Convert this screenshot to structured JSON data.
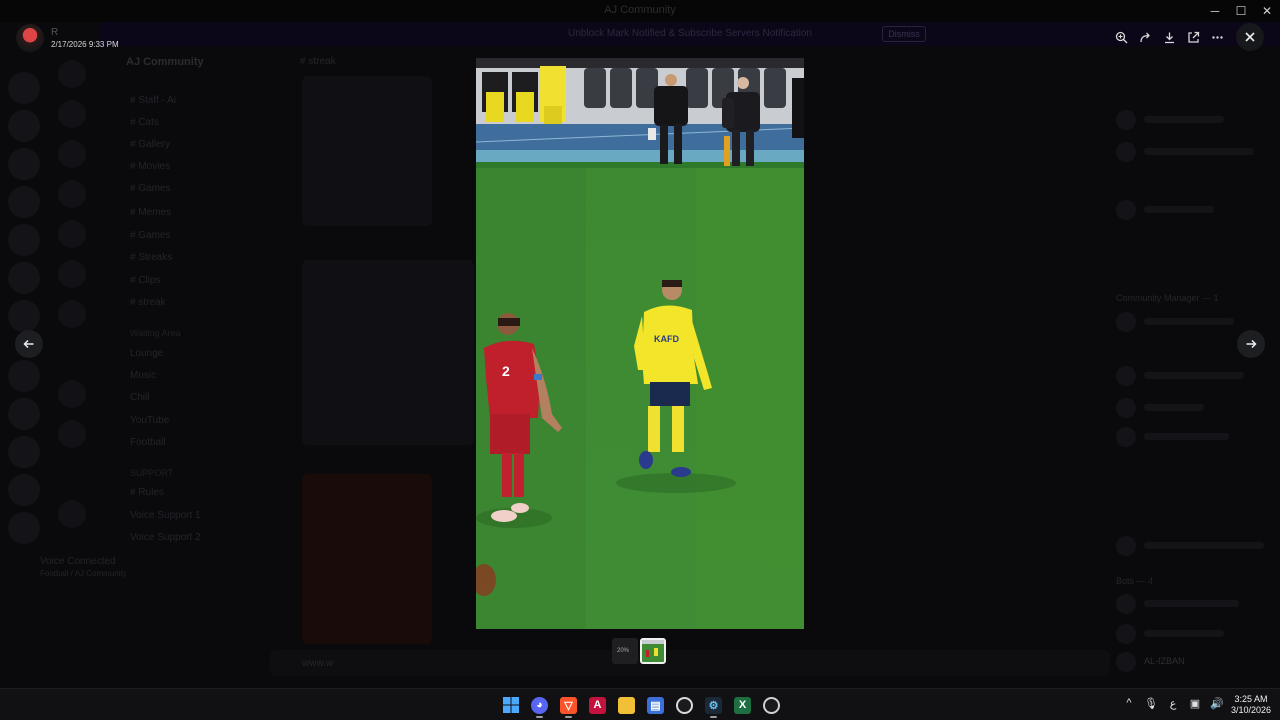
{
  "window": {
    "title": "AJ Community"
  },
  "banner": {
    "text": "Unblock Mark Notified & Subscribe Servers Notification",
    "button": "Dismiss"
  },
  "server": {
    "name": "AJ Community",
    "chat_header": "# streak"
  },
  "channels": [
    {
      "label": "# Staff - Ai"
    },
    {
      "label": "# Cats"
    },
    {
      "label": "# Gallery"
    },
    {
      "label": "# Movies"
    },
    {
      "label": "# Games"
    },
    {
      "label": "# Memes"
    },
    {
      "label": "# Games"
    },
    {
      "label": "# Streaks"
    },
    {
      "label": "# Clips"
    },
    {
      "label": "# streak"
    }
  ],
  "voice_category": "Waiting Area",
  "voice_channels": [
    {
      "label": "Lounge"
    },
    {
      "label": "Music"
    },
    {
      "label": "Chill"
    },
    {
      "label": "YouTube"
    },
    {
      "label": "Football"
    }
  ],
  "support_category": "SUPPORT",
  "support_channels": [
    {
      "label": "# Rules"
    },
    {
      "label": "Voice Support 1"
    },
    {
      "label": "Voice Support 2"
    }
  ],
  "voice_status": {
    "title": "Voice Connected",
    "subtitle": "Football / AJ Community"
  },
  "chat_input": {
    "placeholder": "www.w"
  },
  "members": {
    "header_1": "Community Manager — 1",
    "header_2": "Bots — 4",
    "names": [
      "AL-IZBAN"
    ]
  },
  "viewer": {
    "uploader_name": "R",
    "upload_date": "2/17/2026 9:33 PM",
    "tools": [
      "zoom-in-icon",
      "forward-icon",
      "download-icon",
      "open-external-icon",
      "more-icon"
    ],
    "close_icon": "close-icon",
    "prev_icon": "arrow-left-icon",
    "next_icon": "arrow-right-icon",
    "thumbnails": [
      {
        "label": "20%",
        "selected": false
      },
      {
        "label": "",
        "selected": true
      }
    ],
    "photo": {
      "description_colors": {
        "pitch": "#3f8a34",
        "red_kit": "#c0202a",
        "yellow_kit": "#f0e020"
      },
      "jersey_text": "KAFD"
    }
  },
  "taskbar": {
    "apps": [
      {
        "name": "windows-start-icon",
        "color": "#4aa8ff"
      },
      {
        "name": "discord-icon",
        "color": "#5865f2"
      },
      {
        "name": "brave-browser-icon",
        "color": "#fb542b"
      },
      {
        "name": "affinity-icon",
        "color": "#c3123e"
      },
      {
        "name": "file-explorer-icon",
        "color": "#f2c037"
      },
      {
        "name": "app-icon",
        "color": "#3c6fd8"
      },
      {
        "name": "obs-icon",
        "color": "#d8d8d8"
      },
      {
        "name": "steam-icon",
        "color": "#66c0f4"
      },
      {
        "name": "excel-icon",
        "color": "#1d6f42"
      },
      {
        "name": "chrome-icon",
        "color": "#d0d0d0"
      }
    ],
    "tray": {
      "chevron": "^",
      "mic": "🎙",
      "lang": "ع",
      "net": "▣",
      "vol": "🔊"
    },
    "clock": {
      "time": "3:25 AM",
      "date": "3/10/2026"
    }
  }
}
